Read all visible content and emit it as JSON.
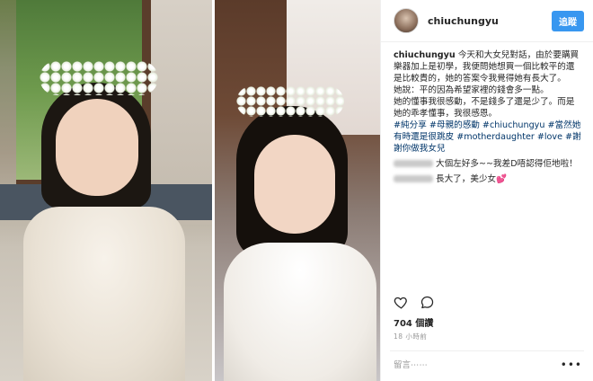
{
  "post": {
    "username": "chiuchungyu",
    "follow_label": "追蹤",
    "caption_user": "chiuchungyu",
    "caption_text": " 今天和大女兒對話，由於要購買樂器加上是初學，我便問她想買一個比較平的還是比較貴的，她的答案令我覺得她有長大了。",
    "caption_quote": "她說：平的因為希望家裡的錢會多一點。",
    "caption_more": "她的懂事我很感動，不是錢多了還是少了。而是她的乖孝懂事，我很感恩。",
    "hashtags": "#純分享 #母親的感動 #chiuchungyu #當然她有時還是很跳皮 #motherdaughter #love #謝謝你做我女兒"
  },
  "comments": [
    {
      "text": "大個左好多~~我差D唔認得佢地啦！"
    },
    {
      "text": "長大了，美少女",
      "emoji": "💕"
    }
  ],
  "stats": {
    "likes": "704 個讚",
    "time": "18 小時前"
  },
  "comment_input": {
    "placeholder": "留言⋯⋯",
    "more": "•••"
  },
  "icons": [
    "heart-icon",
    "comment-icon",
    "more-icon"
  ]
}
